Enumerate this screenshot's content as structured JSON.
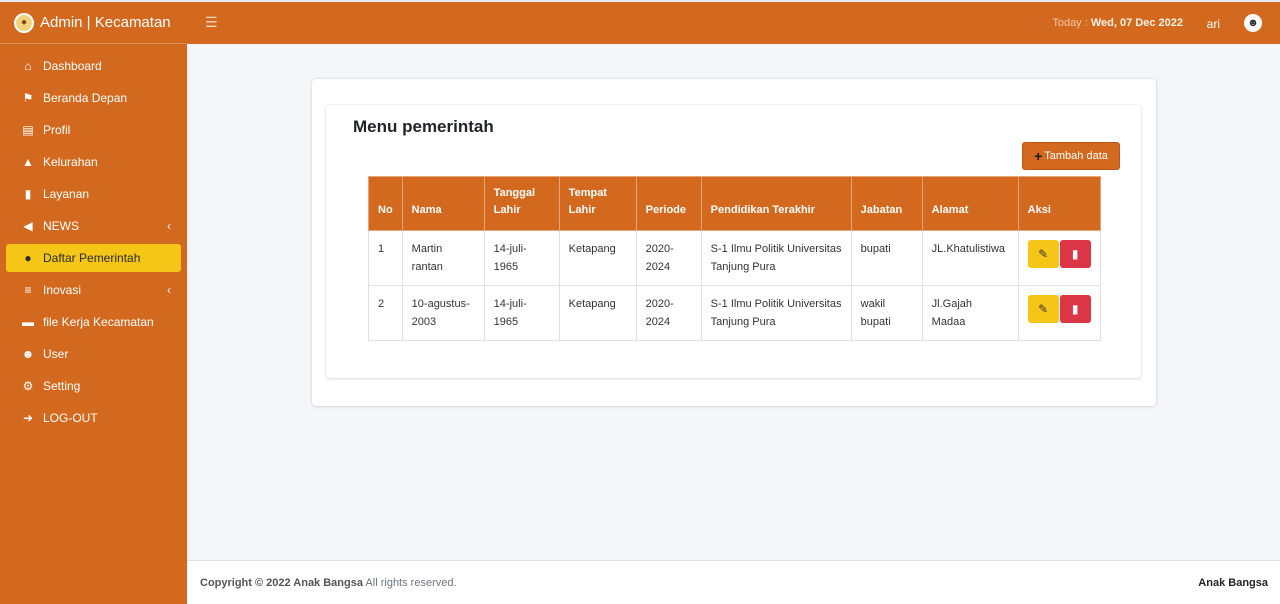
{
  "app": {
    "brand": "Admin | Kecamatan"
  },
  "sidebar": {
    "items": [
      {
        "label": "Dashboard",
        "icon": "home-icon"
      },
      {
        "label": "Beranda Depan",
        "icon": "tags-icon"
      },
      {
        "label": "Profil",
        "icon": "file-icon"
      },
      {
        "label": "Kelurahan",
        "icon": "building-icon"
      },
      {
        "label": "Layanan",
        "icon": "document-icon"
      },
      {
        "label": "NEWS",
        "icon": "megaphone-icon"
      },
      {
        "label": "Daftar Pemerintah",
        "icon": "users-icon"
      },
      {
        "label": "Inovasi",
        "icon": "list-icon"
      },
      {
        "label": "file Kerja Kecamatan",
        "icon": "folder-icon"
      },
      {
        "label": "User",
        "icon": "user-icon"
      },
      {
        "label": "Setting",
        "icon": "gear-icon"
      },
      {
        "label": "LOG-OUT",
        "icon": "logout-icon"
      }
    ]
  },
  "navbar": {
    "today_label": "Today : ",
    "date": "Wed, 07 Dec 2022",
    "username": "ari"
  },
  "main": {
    "title": "Menu pemerintah",
    "add_button": "Tambah data",
    "table": {
      "headers": [
        "No",
        "Nama",
        "Tanggal Lahir",
        "Tempat Lahir",
        "Periode",
        "Pendidikan Terakhir",
        "Jabatan",
        "Alamat",
        "Aksi"
      ],
      "rows": [
        [
          "1",
          "Martin rantan",
          "14-juli-1965",
          "Ketapang",
          "2020-2024",
          "S-1 Ilmu Politik Universitas Tanjung Pura",
          "bupati",
          "JL.Khatulistiwa"
        ],
        [
          "2",
          "10-agustus-2003",
          "14-juli-1965",
          "Ketapang",
          "2020-2024",
          "S-1 Ilmu Politik Universitas Tanjung Pura",
          "wakil bupati",
          "Jl.Gajah Madaa"
        ]
      ]
    }
  },
  "footer": {
    "copyright_prefix": "Copyright © 2022 ",
    "copyright_brand": "Anak Bangsa",
    "copyright_suffix": " All rights reserved.",
    "right_text": "Anak Bangsa"
  },
  "colors": {
    "accent": "#d2691e",
    "active": "#f5c518",
    "danger": "#dc3545"
  }
}
